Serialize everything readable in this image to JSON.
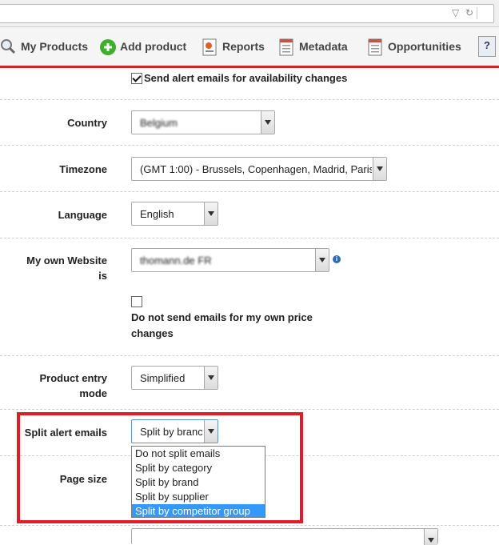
{
  "toolbar": {
    "items": [
      {
        "label": "My Products"
      },
      {
        "label": "Add product"
      },
      {
        "label": "Reports"
      },
      {
        "label": "Metadata"
      },
      {
        "label": "Opportunities"
      }
    ],
    "help_label": "?"
  },
  "form": {
    "alert_checkbox_label": "Send alert emails for availability changes",
    "country": {
      "label": "Country",
      "value": "Belgium"
    },
    "timezone": {
      "label": "Timezone",
      "value": "(GMT 1:00) - Brussels, Copenhagen, Madrid, Paris"
    },
    "language": {
      "label": "Language",
      "value": "English"
    },
    "website": {
      "label_line1": "My own Website",
      "label_line2": "is",
      "value": "thomann.de FR"
    },
    "own_price_checkbox": {
      "line1": "Do not send emails for my own price",
      "line2": "changes"
    },
    "product_entry": {
      "label_line1": "Product entry",
      "label_line2": "mode",
      "value": "Simplified"
    },
    "split_alert": {
      "label": "Split alert emails",
      "value": "Split by branc",
      "options": [
        "Do not split emails",
        "Split by category",
        "Split by brand",
        "Split by supplier",
        "Split by competitor group"
      ],
      "highlighted_index": 4
    },
    "page_size": {
      "label": "Page size"
    }
  }
}
